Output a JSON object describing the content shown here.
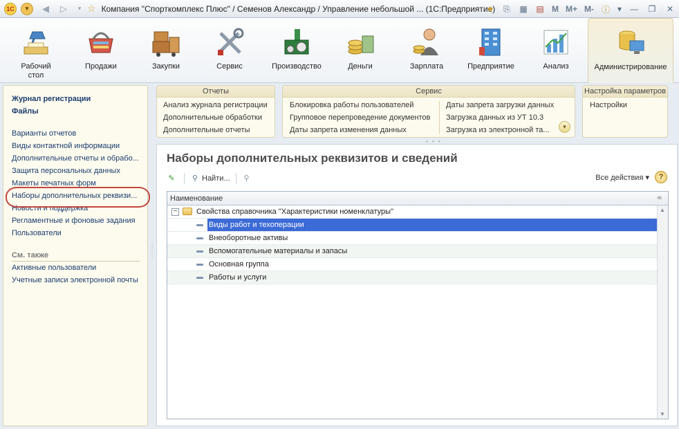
{
  "window": {
    "title": "Компания \"Спорткомплекс Плюс\" / Семенов Александр / Управление небольшой ...  (1С:Предприятие)",
    "memory_buttons": [
      "M",
      "M+",
      "M-"
    ]
  },
  "sections": [
    {
      "label": "Рабочий\nстол",
      "icon": "desk-lamp-icon"
    },
    {
      "label": "Продажи",
      "icon": "shopping-basket-icon"
    },
    {
      "label": "Закупки",
      "icon": "boxes-cart-icon"
    },
    {
      "label": "Сервис",
      "icon": "tools-icon"
    },
    {
      "label": "Производство",
      "icon": "factory-icon"
    },
    {
      "label": "Деньги",
      "icon": "coins-icon"
    },
    {
      "label": "Зарплата",
      "icon": "employee-icon"
    },
    {
      "label": "Предприятие",
      "icon": "building-icon"
    },
    {
      "label": "Анализ",
      "icon": "chart-icon"
    },
    {
      "label": "Администрирование",
      "icon": "database-computer-icon",
      "active": true
    }
  ],
  "left_panel": {
    "bold_links": [
      "Журнал регистрации",
      "Файлы"
    ],
    "links": [
      "Варианты отчетов",
      "Виды контактной информации",
      "Дополнительные отчеты и обрабо...",
      "Защита персональных данных",
      "Макеты печатных форм",
      "Наборы дополнительных реквизи...",
      "Новости и поддержка",
      "Регламентные и фоновые задания",
      "Пользователи"
    ],
    "see_also_title": "См. также",
    "see_also": [
      "Активные пользователи",
      "Учетные записи электронной почты"
    ]
  },
  "command_panels": {
    "reports": {
      "title": "Отчеты",
      "items": [
        "Анализ журнала регистрации",
        "Дополнительные обработки",
        "Дополнительные отчеты"
      ]
    },
    "service": {
      "title": "Сервис",
      "col1": [
        "Блокировка работы пользователей",
        "Групповое перепроведение документов",
        "Даты запрета изменения данных"
      ],
      "col2": [
        "Даты запрета загрузки данных",
        "Загрузка данных из УТ 10.3",
        "Загрузка из электронной та..."
      ]
    },
    "settings": {
      "title": "Настройка параметров",
      "items": [
        "Настройки"
      ]
    }
  },
  "form": {
    "title": "Наборы дополнительных реквизитов и сведений",
    "toolbar": {
      "find_label": "Найти...",
      "all_actions_label": "Все действия ▾"
    },
    "table": {
      "column_header": "Наименование",
      "group_row": "Свойства справочника \"Характеристики номенклатуры\"",
      "rows": [
        "Виды работ и техоперации",
        "Внеоборотные активы",
        "Вспомогательные материалы и запасы",
        "Основная группа",
        "Работы и услуги"
      ],
      "selected_index": 0
    }
  }
}
